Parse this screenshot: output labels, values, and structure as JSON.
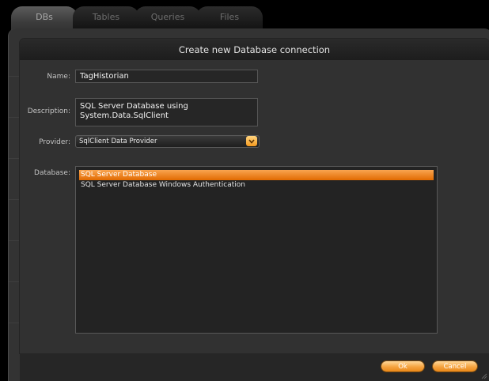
{
  "tabs": [
    {
      "label": "DBs",
      "active": true
    },
    {
      "label": "Tables",
      "active": false
    },
    {
      "label": "Queries",
      "active": false
    },
    {
      "label": "Files",
      "active": false
    }
  ],
  "dialog": {
    "title": "Create new Database connection",
    "name_label": "Name:",
    "name_value": "TagHistorian",
    "description_label": "Description:",
    "description_value": "SQL Server Database using System.Data.SqlClient",
    "provider_label": "Provider:",
    "provider_value": "SqlClient Data Provider",
    "database_label": "Database:",
    "databases": [
      {
        "label": "SQL Server Database",
        "selected": true
      },
      {
        "label": "SQL Server Database Windows Authentication",
        "selected": false
      }
    ],
    "ok_label": "Ok",
    "cancel_label": "Cancel"
  },
  "colors": {
    "accent": "#f08c1e",
    "selection": "#e97a10",
    "panel": "#313131"
  },
  "icons": {
    "dropdown": "chevron-down-icon",
    "grip": "resize-grip-icon"
  }
}
